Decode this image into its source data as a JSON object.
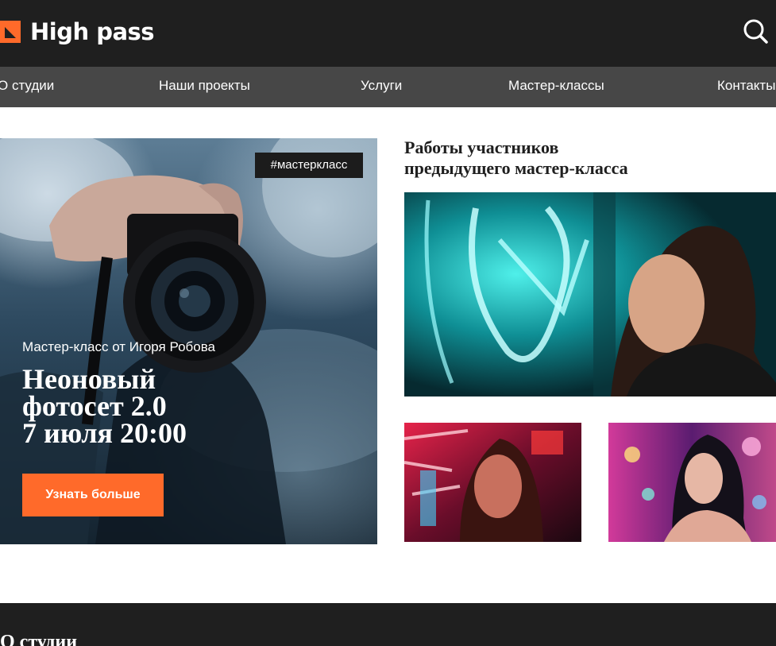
{
  "header": {
    "logo_text": "High pass",
    "brand_color": "#ff6a2a",
    "search_icon": "search-icon"
  },
  "nav": {
    "items": [
      {
        "label": "О студии"
      },
      {
        "label": "Наши проекты"
      },
      {
        "label": "Услуги"
      },
      {
        "label": "Мастер-классы"
      },
      {
        "label": "Контакты"
      }
    ]
  },
  "hero": {
    "tag": "#мастеркласс",
    "subtitle": "Мастер-класс от Игоря Робова",
    "title": "Неоновый\nфотосет 2.0\n7 июля 20:00",
    "button_label": "Узнать больше"
  },
  "works": {
    "title": "Работы участников\nпредыдущего мастер-класса"
  },
  "about": {
    "title": "О студии"
  }
}
